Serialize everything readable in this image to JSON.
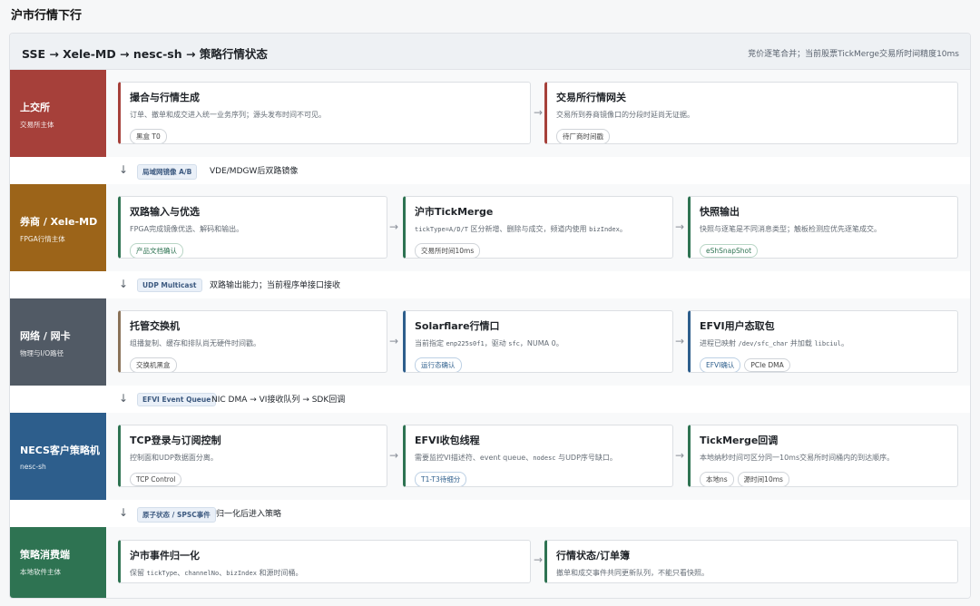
{
  "page_title": "沪市行情下行",
  "header": {
    "title": "SSE → Xele-MD → nesc-sh → 策略行情状态",
    "note": "竞价逐笔合并；当前股票TickMerge交易所时间精度10ms"
  },
  "lanes": [
    {
      "name": "上交所",
      "sub": "交易所主体",
      "color": "#a6403a",
      "nodes": [
        {
          "title": "撮合与行情生成",
          "desc": "订单、撤单和成交进入统一业务序列；源头发布时间不可见。",
          "tags": [
            "黑盒 T0"
          ]
        },
        {
          "title": "交易所行情网关",
          "desc": "交易所到券商镜像口的分段时延尚无证据。",
          "tags": [
            "待厂商时间戳"
          ]
        }
      ]
    },
    {
      "name": "券商 / Xele-MD",
      "sub": "FPGA行情主体",
      "color": "#9c6419",
      "nodes": [
        {
          "title": "双路输入与优选",
          "desc": "FPGA完成镜像优选、解码和输出。",
          "tags": [
            "产品文档确认"
          ]
        },
        {
          "title": "沪市TickMerge",
          "desc_pre": "",
          "code1": "tickType=A/D/T",
          "desc_mid": " 区分新增、删除与成交，频道内使用 ",
          "code2": "bizIndex",
          "desc_post": "。",
          "tags": [
            "交易所时间10ms"
          ]
        },
        {
          "title": "快照输出",
          "desc": "快照与逐笔是不同消息类型；触板检测应优先逐笔成交。",
          "tags": [
            "eShSnapShot"
          ]
        }
      ]
    },
    {
      "name": "网络 / 网卡",
      "sub": "物理与I/O路径",
      "color": "#515a65",
      "nodes": [
        {
          "title": "托管交换机",
          "desc": "组播复制、缓存和排队尚无硬件时间戳。",
          "tags": [
            "交换机黑盒"
          ]
        },
        {
          "title": "Solarflare行情口",
          "desc_pre": "当前指定 ",
          "code1": "enp225s0f1",
          "desc_mid": "，驱动 ",
          "code2": "sfc",
          "desc_post": "，NUMA 0。",
          "tags": [
            "运行态确认"
          ]
        },
        {
          "title": "EFVI用户态取包",
          "desc_pre": "进程已映射 ",
          "code1": "/dev/sfc_char",
          "desc_mid": " 并加载 ",
          "code2": "libciul",
          "desc_post": "。",
          "tags": [
            "EFVI确认",
            "PCIe DMA"
          ]
        }
      ]
    },
    {
      "name": "NECS客户策略机",
      "sub": "nesc-sh",
      "color": "#2d5e8c",
      "nodes": [
        {
          "title": "TCP登录与订阅控制",
          "desc": "控制面和UDP数据面分离。",
          "tags": [
            "TCP Control"
          ]
        },
        {
          "title": "EFVI收包线程",
          "desc_pre": "需要监控VI描述符、event queue、",
          "code1": "nodesc",
          "desc_mid": " 与UDP序号缺口。",
          "code2": "",
          "desc_post": "",
          "tags": [
            "T1-T3待细分"
          ]
        },
        {
          "title": "TickMerge回调",
          "desc": "本地纳秒时间可区分同一10ms交易所时间桶内的到达顺序。",
          "tags": [
            "本地ns",
            "源时间10ms"
          ]
        }
      ]
    },
    {
      "name": "策略消费端",
      "sub": "本地软件主体",
      "color": "#2e7352",
      "nodes": [
        {
          "title": "沪市事件归一化",
          "desc_pre": "保留 ",
          "code1": "tickType",
          "desc_mid": "、",
          "code2": "channelNo",
          "desc_post": "、",
          "code3": "bizIndex",
          "desc_tail": " 和源时间桶。",
          "tags": []
        },
        {
          "title": "行情状态/订单簿",
          "desc": "撤单和成交事件共同更新队列，不能只看快照。",
          "tags": []
        }
      ]
    }
  ],
  "connectors": [
    {
      "badge": "局域网镜像 A/B",
      "text": "VDE/MDGW后双路镜像"
    },
    {
      "badge": "UDP Multicast",
      "text": "双路输出能力；当前程序单接口接收"
    },
    {
      "badge": "EFVI Event Queue",
      "text": "NIC DMA → VI接收队列 → SDK回调"
    },
    {
      "badge": "原子状态 / SPSC事件",
      "text": "归一化后进入策略"
    }
  ],
  "glyphs": {
    "down_arrow": "↓",
    "right_arrow": "→"
  }
}
